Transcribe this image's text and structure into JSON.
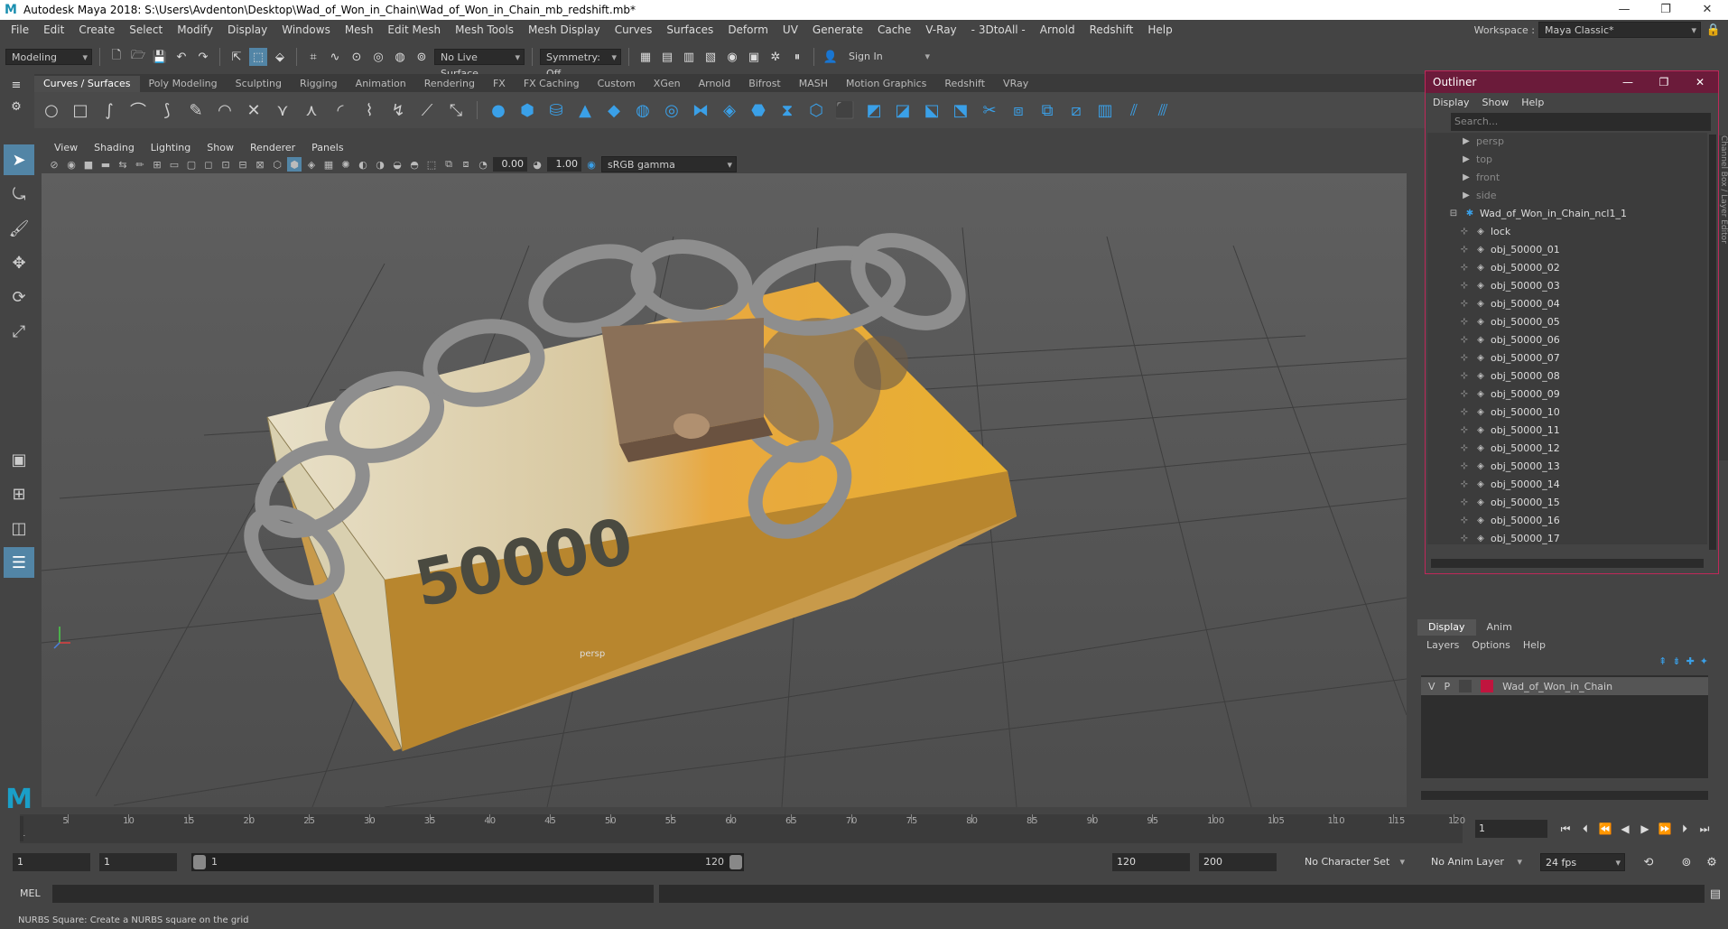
{
  "window": {
    "title": "Autodesk Maya 2018: S:\\Users\\Avdenton\\Desktop\\Wad_of_Won_in_Chain\\Wad_of_Won_in_Chain_mb_redshift.mb*",
    "controls": [
      "—",
      "❐",
      "✕"
    ]
  },
  "menubar": {
    "items": [
      "File",
      "Edit",
      "Create",
      "Select",
      "Modify",
      "Display",
      "Windows",
      "Mesh",
      "Edit Mesh",
      "Mesh Tools",
      "Mesh Display",
      "Curves",
      "Surfaces",
      "Deform",
      "UV",
      "Generate",
      "Cache",
      "V-Ray",
      "- 3DtoAll -",
      "Arnold",
      "Redshift",
      "Help"
    ],
    "workspace_label": "Workspace :",
    "workspace_value": "Maya Classic*"
  },
  "statusline": {
    "mode": "Modeling",
    "live_surface": "No Live Surface",
    "symmetry": "Symmetry: Off",
    "sign_in": "Sign In"
  },
  "shelf": {
    "tabs": [
      "Curves / Surfaces",
      "Poly Modeling",
      "Sculpting",
      "Rigging",
      "Animation",
      "Rendering",
      "FX",
      "FX Caching",
      "Custom",
      "XGen",
      "Arnold",
      "Bifrost",
      "MASH",
      "Motion Graphics",
      "Redshift",
      "VRay"
    ],
    "active_tab": "Curves / Surfaces"
  },
  "viewport": {
    "menu": [
      "View",
      "Shading",
      "Lighting",
      "Show",
      "Renderer",
      "Panels"
    ],
    "exposure": "0.00",
    "gamma": "1.00",
    "color_space": "sRGB gamma",
    "camera_label": "persp",
    "axis_y": "y",
    "axis_x": "x"
  },
  "outliner": {
    "title": "Outliner",
    "menu": [
      "Display",
      "Show",
      "Help"
    ],
    "search_placeholder": "Search...",
    "cameras": [
      "persp",
      "top",
      "front",
      "side"
    ],
    "group": "Wad_of_Won_in_Chain_ncl1_1",
    "children": [
      "lock",
      "obj_50000_01",
      "obj_50000_02",
      "obj_50000_03",
      "obj_50000_04",
      "obj_50000_05",
      "obj_50000_06",
      "obj_50000_07",
      "obj_50000_08",
      "obj_50000_09",
      "obj_50000_10",
      "obj_50000_11",
      "obj_50000_12",
      "obj_50000_13",
      "obj_50000_14",
      "obj_50000_15",
      "obj_50000_16",
      "obj_50000_17"
    ]
  },
  "channel_box_tab": "Channel Box / Layer Editor",
  "layers": {
    "tabs": [
      "Display",
      "Anim"
    ],
    "menu": [
      "Layers",
      "Options",
      "Help"
    ],
    "row": {
      "v": "V",
      "p": "P",
      "name": "Wad_of_Won_in_Chain",
      "color": "#c0153e"
    }
  },
  "timeline": {
    "ticks": [
      "5",
      "10",
      "15",
      "20",
      "25",
      "30",
      "35",
      "40",
      "45",
      "50",
      "55",
      "60",
      "65",
      "70",
      "75",
      "80",
      "85",
      "90",
      "95",
      "100",
      "105",
      "110",
      "115",
      "120"
    ],
    "start_label": "1",
    "current_frame": "1"
  },
  "range": {
    "start": "1",
    "anim_start": "1",
    "slider_start": "1",
    "slider_end": "120",
    "playback_end": "120",
    "anim_end": "200",
    "character_set": "No Character Set",
    "anim_layer": "No Anim Layer",
    "fps": "24 fps"
  },
  "mel": {
    "label": "MEL"
  },
  "help_line": "NURBS Square: Create a NURBS square on the grid",
  "colors": {
    "outliner_header": "#6b1b3a",
    "selection": "#5285a6",
    "accent": "#3aa0e8"
  }
}
